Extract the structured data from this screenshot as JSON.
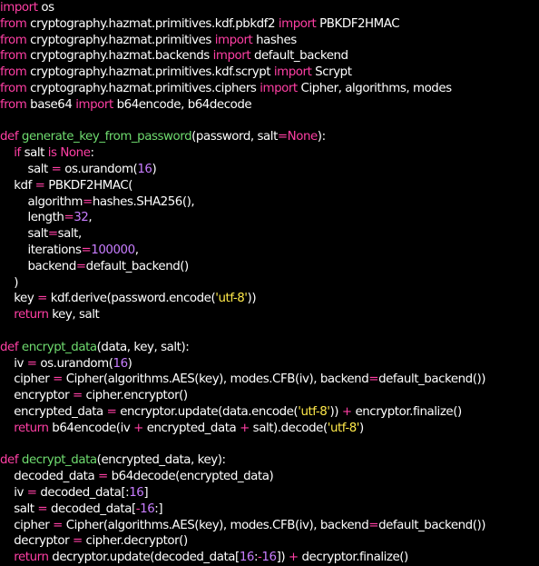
{
  "colors": {
    "background": "#000000",
    "plain": "#ffffff",
    "keyword": "#ff3fa4",
    "function_name": "#6fdc6f",
    "number": "#c87dff",
    "string": "#ffe94a"
  },
  "code": {
    "lines": [
      [
        {
          "t": "kw",
          "v": "import"
        },
        {
          "t": "plain",
          "v": " os"
        }
      ],
      [
        {
          "t": "kw",
          "v": "from"
        },
        {
          "t": "plain",
          "v": " cryptography.hazmat.primitives.kdf.pbkdf2 "
        },
        {
          "t": "kw",
          "v": "import"
        },
        {
          "t": "plain",
          "v": " PBKDF2HMAC"
        }
      ],
      [
        {
          "t": "kw",
          "v": "from"
        },
        {
          "t": "plain",
          "v": " cryptography.hazmat.primitives "
        },
        {
          "t": "kw",
          "v": "import"
        },
        {
          "t": "plain",
          "v": " hashes"
        }
      ],
      [
        {
          "t": "kw",
          "v": "from"
        },
        {
          "t": "plain",
          "v": " cryptography.hazmat.backends "
        },
        {
          "t": "kw",
          "v": "import"
        },
        {
          "t": "plain",
          "v": " default_backend"
        }
      ],
      [
        {
          "t": "kw",
          "v": "from"
        },
        {
          "t": "plain",
          "v": " cryptography.hazmat.primitives.kdf.scrypt "
        },
        {
          "t": "kw",
          "v": "import"
        },
        {
          "t": "plain",
          "v": " Scrypt"
        }
      ],
      [
        {
          "t": "kw",
          "v": "from"
        },
        {
          "t": "plain",
          "v": " cryptography.hazmat.primitives.ciphers "
        },
        {
          "t": "kw",
          "v": "import"
        },
        {
          "t": "plain",
          "v": " Cipher, algorithms, modes"
        }
      ],
      [
        {
          "t": "kw",
          "v": "from"
        },
        {
          "t": "plain",
          "v": " base64 "
        },
        {
          "t": "kw",
          "v": "import"
        },
        {
          "t": "plain",
          "v": " b64encode, b64decode"
        }
      ],
      [],
      [
        {
          "t": "kw",
          "v": "def"
        },
        {
          "t": "plain",
          "v": " "
        },
        {
          "t": "fn",
          "v": "generate_key_from_password"
        },
        {
          "t": "plain",
          "v": "(password, salt"
        },
        {
          "t": "kw",
          "v": "="
        },
        {
          "t": "kw",
          "v": "None"
        },
        {
          "t": "plain",
          "v": "):"
        }
      ],
      [
        {
          "t": "plain",
          "v": "    "
        },
        {
          "t": "kw",
          "v": "if"
        },
        {
          "t": "plain",
          "v": " salt "
        },
        {
          "t": "kw",
          "v": "is"
        },
        {
          "t": "plain",
          "v": " "
        },
        {
          "t": "kw",
          "v": "None"
        },
        {
          "t": "plain",
          "v": ":"
        }
      ],
      [
        {
          "t": "plain",
          "v": "        salt "
        },
        {
          "t": "kw",
          "v": "="
        },
        {
          "t": "plain",
          "v": " os.urandom("
        },
        {
          "t": "num",
          "v": "16"
        },
        {
          "t": "plain",
          "v": ")"
        }
      ],
      [
        {
          "t": "plain",
          "v": "    kdf "
        },
        {
          "t": "kw",
          "v": "="
        },
        {
          "t": "plain",
          "v": " PBKDF2HMAC("
        }
      ],
      [
        {
          "t": "plain",
          "v": "        algorithm"
        },
        {
          "t": "kw",
          "v": "="
        },
        {
          "t": "plain",
          "v": "hashes.SHA256(),"
        }
      ],
      [
        {
          "t": "plain",
          "v": "        length"
        },
        {
          "t": "kw",
          "v": "="
        },
        {
          "t": "num",
          "v": "32"
        },
        {
          "t": "plain",
          "v": ","
        }
      ],
      [
        {
          "t": "plain",
          "v": "        salt"
        },
        {
          "t": "kw",
          "v": "="
        },
        {
          "t": "plain",
          "v": "salt,"
        }
      ],
      [
        {
          "t": "plain",
          "v": "        iterations"
        },
        {
          "t": "kw",
          "v": "="
        },
        {
          "t": "num",
          "v": "100000"
        },
        {
          "t": "plain",
          "v": ","
        }
      ],
      [
        {
          "t": "plain",
          "v": "        backend"
        },
        {
          "t": "kw",
          "v": "="
        },
        {
          "t": "plain",
          "v": "default_backend()"
        }
      ],
      [
        {
          "t": "plain",
          "v": "    )"
        }
      ],
      [
        {
          "t": "plain",
          "v": "    key "
        },
        {
          "t": "kw",
          "v": "="
        },
        {
          "t": "plain",
          "v": " kdf.derive(password.encode("
        },
        {
          "t": "str",
          "v": "'utf-8'"
        },
        {
          "t": "plain",
          "v": "))"
        }
      ],
      [
        {
          "t": "plain",
          "v": "    "
        },
        {
          "t": "kw",
          "v": "return"
        },
        {
          "t": "plain",
          "v": " key, salt"
        }
      ],
      [],
      [
        {
          "t": "kw",
          "v": "def"
        },
        {
          "t": "plain",
          "v": " "
        },
        {
          "t": "fn",
          "v": "encrypt_data"
        },
        {
          "t": "plain",
          "v": "(data, key, salt):"
        }
      ],
      [
        {
          "t": "plain",
          "v": "    iv "
        },
        {
          "t": "kw",
          "v": "="
        },
        {
          "t": "plain",
          "v": " os.urandom("
        },
        {
          "t": "num",
          "v": "16"
        },
        {
          "t": "plain",
          "v": ")"
        }
      ],
      [
        {
          "t": "plain",
          "v": "    cipher "
        },
        {
          "t": "kw",
          "v": "="
        },
        {
          "t": "plain",
          "v": " Cipher(algorithms.AES(key), modes.CFB(iv), backend"
        },
        {
          "t": "kw",
          "v": "="
        },
        {
          "t": "plain",
          "v": "default_backend())"
        }
      ],
      [
        {
          "t": "plain",
          "v": "    encryptor "
        },
        {
          "t": "kw",
          "v": "="
        },
        {
          "t": "plain",
          "v": " cipher.encryptor()"
        }
      ],
      [
        {
          "t": "plain",
          "v": "    encrypted_data "
        },
        {
          "t": "kw",
          "v": "="
        },
        {
          "t": "plain",
          "v": " encryptor.update(data.encode("
        },
        {
          "t": "str",
          "v": "'utf-8'"
        },
        {
          "t": "plain",
          "v": ")) "
        },
        {
          "t": "kw",
          "v": "+"
        },
        {
          "t": "plain",
          "v": " encryptor.finalize()"
        }
      ],
      [
        {
          "t": "plain",
          "v": "    "
        },
        {
          "t": "kw",
          "v": "return"
        },
        {
          "t": "plain",
          "v": " b64encode(iv "
        },
        {
          "t": "kw",
          "v": "+"
        },
        {
          "t": "plain",
          "v": " encrypted_data "
        },
        {
          "t": "kw",
          "v": "+"
        },
        {
          "t": "plain",
          "v": " salt).decode("
        },
        {
          "t": "str",
          "v": "'utf-8'"
        },
        {
          "t": "plain",
          "v": ")"
        }
      ],
      [],
      [
        {
          "t": "kw",
          "v": "def"
        },
        {
          "t": "plain",
          "v": " "
        },
        {
          "t": "fn",
          "v": "decrypt_data"
        },
        {
          "t": "plain",
          "v": "(encrypted_data, key):"
        }
      ],
      [
        {
          "t": "plain",
          "v": "    decoded_data "
        },
        {
          "t": "kw",
          "v": "="
        },
        {
          "t": "plain",
          "v": " b64decode(encrypted_data)"
        }
      ],
      [
        {
          "t": "plain",
          "v": "    iv "
        },
        {
          "t": "kw",
          "v": "="
        },
        {
          "t": "plain",
          "v": " decoded_data[:"
        },
        {
          "t": "num",
          "v": "16"
        },
        {
          "t": "plain",
          "v": "]"
        }
      ],
      [
        {
          "t": "plain",
          "v": "    salt "
        },
        {
          "t": "kw",
          "v": "="
        },
        {
          "t": "plain",
          "v": " decoded_data["
        },
        {
          "t": "kw",
          "v": "-"
        },
        {
          "t": "num",
          "v": "16"
        },
        {
          "t": "plain",
          "v": ":]"
        }
      ],
      [
        {
          "t": "plain",
          "v": "    cipher "
        },
        {
          "t": "kw",
          "v": "="
        },
        {
          "t": "plain",
          "v": " Cipher(algorithms.AES(key), modes.CFB(iv), backend"
        },
        {
          "t": "kw",
          "v": "="
        },
        {
          "t": "plain",
          "v": "default_backend())"
        }
      ],
      [
        {
          "t": "plain",
          "v": "    decryptor "
        },
        {
          "t": "kw",
          "v": "="
        },
        {
          "t": "plain",
          "v": " cipher.decryptor()"
        }
      ],
      [
        {
          "t": "plain",
          "v": "    "
        },
        {
          "t": "kw",
          "v": "return"
        },
        {
          "t": "plain",
          "v": " decryptor.update(decoded_data["
        },
        {
          "t": "num",
          "v": "16"
        },
        {
          "t": "plain",
          "v": ":"
        },
        {
          "t": "kw",
          "v": "-"
        },
        {
          "t": "num",
          "v": "16"
        },
        {
          "t": "plain",
          "v": "]) "
        },
        {
          "t": "kw",
          "v": "+"
        },
        {
          "t": "plain",
          "v": " decryptor.finalize()"
        }
      ]
    ]
  }
}
